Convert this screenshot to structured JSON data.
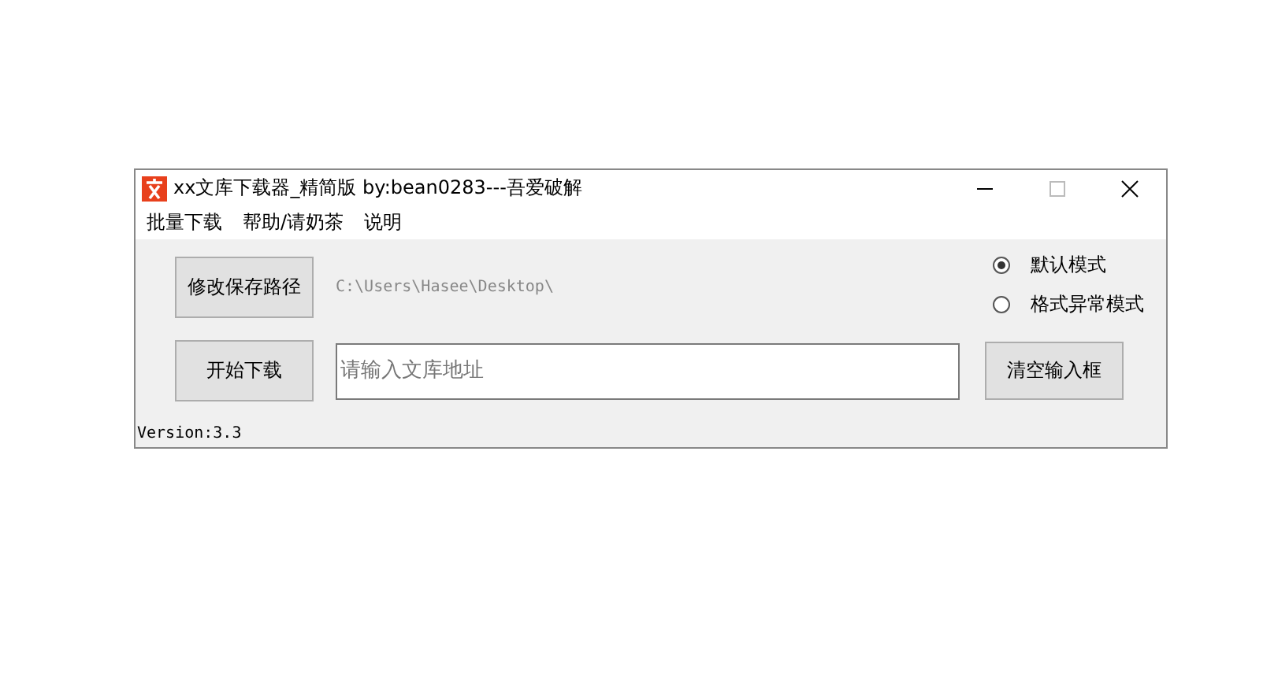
{
  "window": {
    "title": "xx文库下载器_精简版   by:bean0283---吾爱破解"
  },
  "menu": [
    {
      "label": "批量下载"
    },
    {
      "label": "帮助/请奶茶"
    },
    {
      "label": "说明"
    }
  ],
  "save_path": {
    "button": "修改保存路径",
    "path": "C:\\Users\\Hasee\\Desktop\\"
  },
  "modes": [
    {
      "label": "默认模式",
      "selected": true
    },
    {
      "label": "格式异常模式",
      "selected": false
    }
  ],
  "download": {
    "button": "开始下载",
    "placeholder": "请输入文库地址",
    "clear_button": "清空输入框"
  },
  "version": "Version:3.3"
}
